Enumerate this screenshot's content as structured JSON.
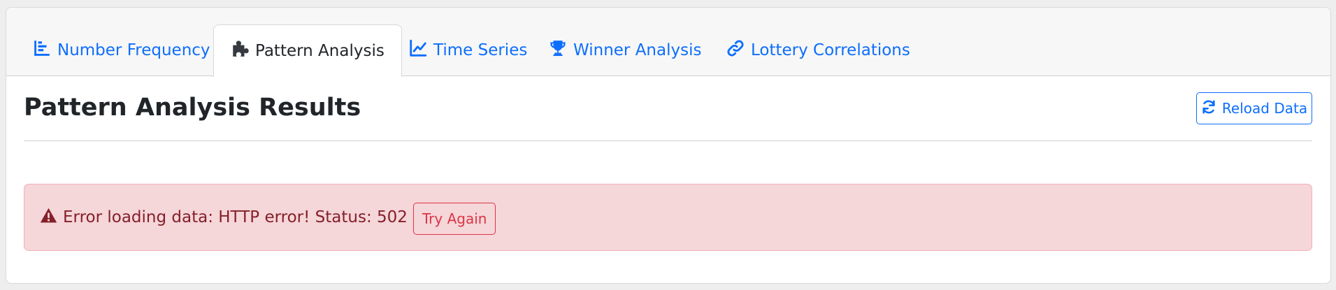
{
  "tabs": [
    {
      "label": "Number Frequency",
      "icon": "bar-chart-icon",
      "active": false
    },
    {
      "label": "Pattern Analysis",
      "icon": "puzzle-piece-icon",
      "active": true
    },
    {
      "label": "Time Series",
      "icon": "line-chart-icon",
      "active": false
    },
    {
      "label": "Winner Analysis",
      "icon": "trophy-icon",
      "active": false
    },
    {
      "label": "Lottery Correlations",
      "icon": "link-icon",
      "active": false
    }
  ],
  "panel": {
    "title": "Pattern Analysis Results",
    "reload_label": "Reload Data",
    "reload_icon": "refresh-icon"
  },
  "alert": {
    "icon": "warning-icon",
    "message": "Error loading data: HTTP error! Status: 502",
    "retry_label": "Try Again"
  },
  "colors": {
    "primary": "#0d6efd",
    "danger": "#dc3545",
    "alert_bg": "#f5d6d9",
    "alert_text": "#842029"
  }
}
